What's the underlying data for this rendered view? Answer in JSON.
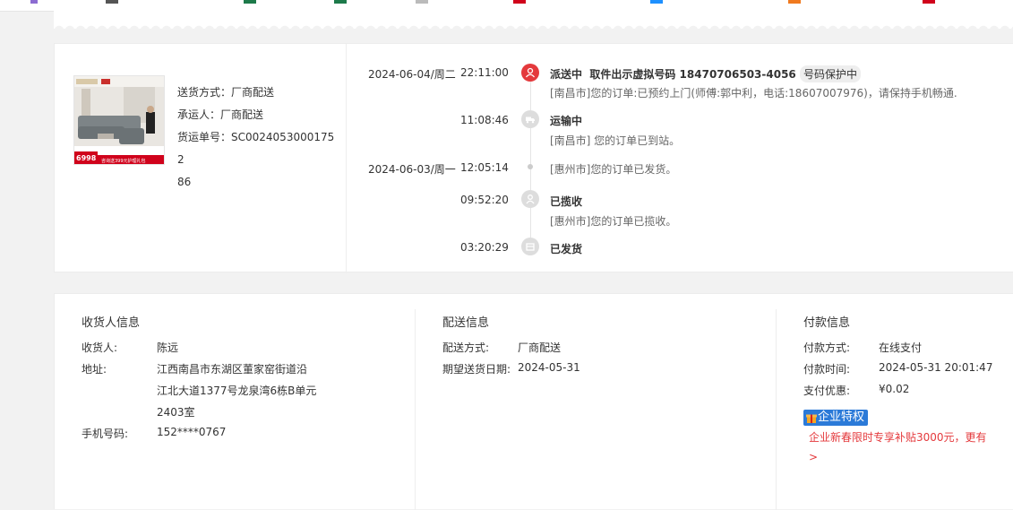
{
  "shipping": {
    "method_label": "送货方式：",
    "method_value": "厂商配送",
    "carrier_label": "承运人：",
    "carrier_value": "厂商配送",
    "waybill_label": "货运单号：",
    "waybill_value": "SC00240530001752",
    "waybill_value_cont": "86",
    "product_price": "6998",
    "product_promo": "咨询送399元护理礼包"
  },
  "tracking": {
    "events": [
      {
        "date": "2024-06-04/周二",
        "time": "22:11:00",
        "status": "派送中",
        "status_extra": "取件出示虚拟号码 18470706503-4056",
        "pill": "号码保护中",
        "desc": "[南昌市]您的订单:已预约上门(师傅:郭中利，电话:18607007976)，请保持手机畅通.",
        "icon": "delivery-person-icon"
      },
      {
        "date": "",
        "time": "11:08:46",
        "status": "运输中",
        "desc": "[南昌市] 您的订单已到站。",
        "icon": "truck-icon"
      },
      {
        "date": "2024-06-03/周一",
        "time": "12:05:14",
        "status": "",
        "desc": "[惠州市]您的订单已发货。",
        "icon": "dot"
      },
      {
        "date": "",
        "time": "09:52:20",
        "status": "已揽收",
        "desc": "[惠州市]您的订单已揽收。",
        "icon": "pickup-icon"
      },
      {
        "date": "",
        "time": "03:20:29",
        "status": "已发货",
        "desc": "",
        "icon": "package-icon"
      }
    ],
    "active_color": "#e4393c"
  },
  "receiver": {
    "title": "收货人信息",
    "name_label": "收货人:",
    "name_value": "陈远",
    "address_label": "地址:",
    "address_line1": "江西南昌市东湖区董家窑街道沿",
    "address_line2": "江北大道1377号龙泉湾6栋B单元",
    "address_line3": "2403室",
    "phone_label": "手机号码:",
    "phone_value": "152****0767"
  },
  "delivery": {
    "title": "配送信息",
    "method_label": "配送方式:",
    "method_value": "厂商配送",
    "expected_label": "期望送货日期:",
    "expected_value": "2024-05-31"
  },
  "payment": {
    "title": "付款信息",
    "method_label": "付款方式:",
    "method_value": "在线支付",
    "time_label": "付款时间:",
    "time_value": "2024-05-31 20:01:47",
    "discount_label": "支付优惠:",
    "discount_value": "¥0.02",
    "badge_label": "企业特权",
    "promo_text": "企业新春限时专享补贴3000元，更有",
    "promo_arrow": ">"
  }
}
